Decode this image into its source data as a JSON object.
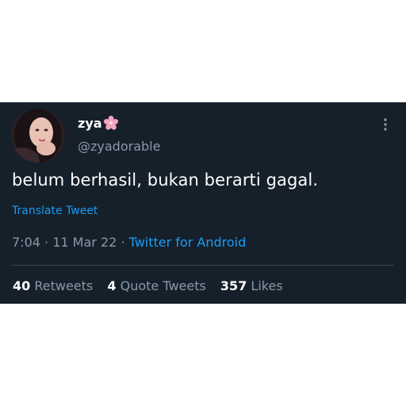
{
  "user": {
    "display_name": "zya",
    "name_emoji_icon": "cherry-blossom-icon",
    "handle": "@zyadorable",
    "avatar_icon": "avatar"
  },
  "tweet": {
    "text": "belum berhasil, bukan berarti gagal.",
    "translate_label": "Translate Tweet",
    "time": "7:04",
    "separator": "·",
    "date": "11 Mar 22",
    "source": "Twitter for Android"
  },
  "stats": {
    "retweets_count": "40",
    "retweets_label": "Retweets",
    "quote_count": "4",
    "quote_label": "Quote Tweets",
    "likes_count": "357",
    "likes_label": "Likes"
  },
  "menu": {
    "icon": "more-vertical-icon"
  },
  "colors": {
    "background": "#15202b",
    "text_primary": "#ffffff",
    "text_secondary": "#8b98a5",
    "link": "#1d9bf0",
    "divider": "#38444d"
  }
}
